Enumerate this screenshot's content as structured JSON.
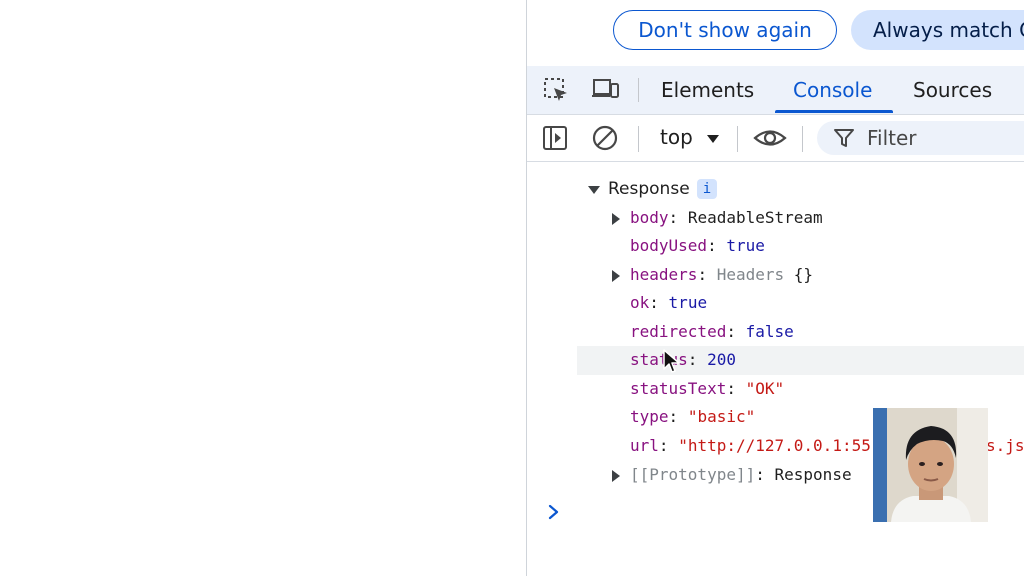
{
  "banner": {
    "dont_show_again": "Don't show again",
    "always_match": "Always match C"
  },
  "tabs": [
    {
      "label": "Elements",
      "active": false
    },
    {
      "label": "Console",
      "active": true
    },
    {
      "label": "Sources",
      "active": false
    }
  ],
  "toolbar": {
    "context": "top",
    "filter_placeholder": "Filter"
  },
  "console": {
    "object_title": "Response",
    "info_badge": "i",
    "props": {
      "body": {
        "key": "body",
        "value": "ReadableStream"
      },
      "bodyUsed": {
        "key": "bodyUsed",
        "value": "true"
      },
      "headers": {
        "key": "headers",
        "type": "Headers",
        "braces": "{}"
      },
      "ok": {
        "key": "ok",
        "value": "true"
      },
      "redirected": {
        "key": "redirected",
        "value": "false"
      },
      "status": {
        "key": "status",
        "value": "200"
      },
      "statusText": {
        "key": "statusText",
        "value": "\"OK\""
      },
      "type": {
        "key": "type",
        "value": "\"basic\""
      },
      "url": {
        "key": "url",
        "value": "\"http://127.0.0.1:55",
        "value_tail": "s.js"
      },
      "prototype": {
        "key": "[[Prototype]]",
        "value": "Response"
      }
    },
    "colon": ":"
  },
  "colors": {
    "accent": "#0b57d0",
    "key": "#881280",
    "boolean": "#1a1aa6",
    "string": "#c41a16",
    "tab_bar_bg": "#edf2fa"
  }
}
